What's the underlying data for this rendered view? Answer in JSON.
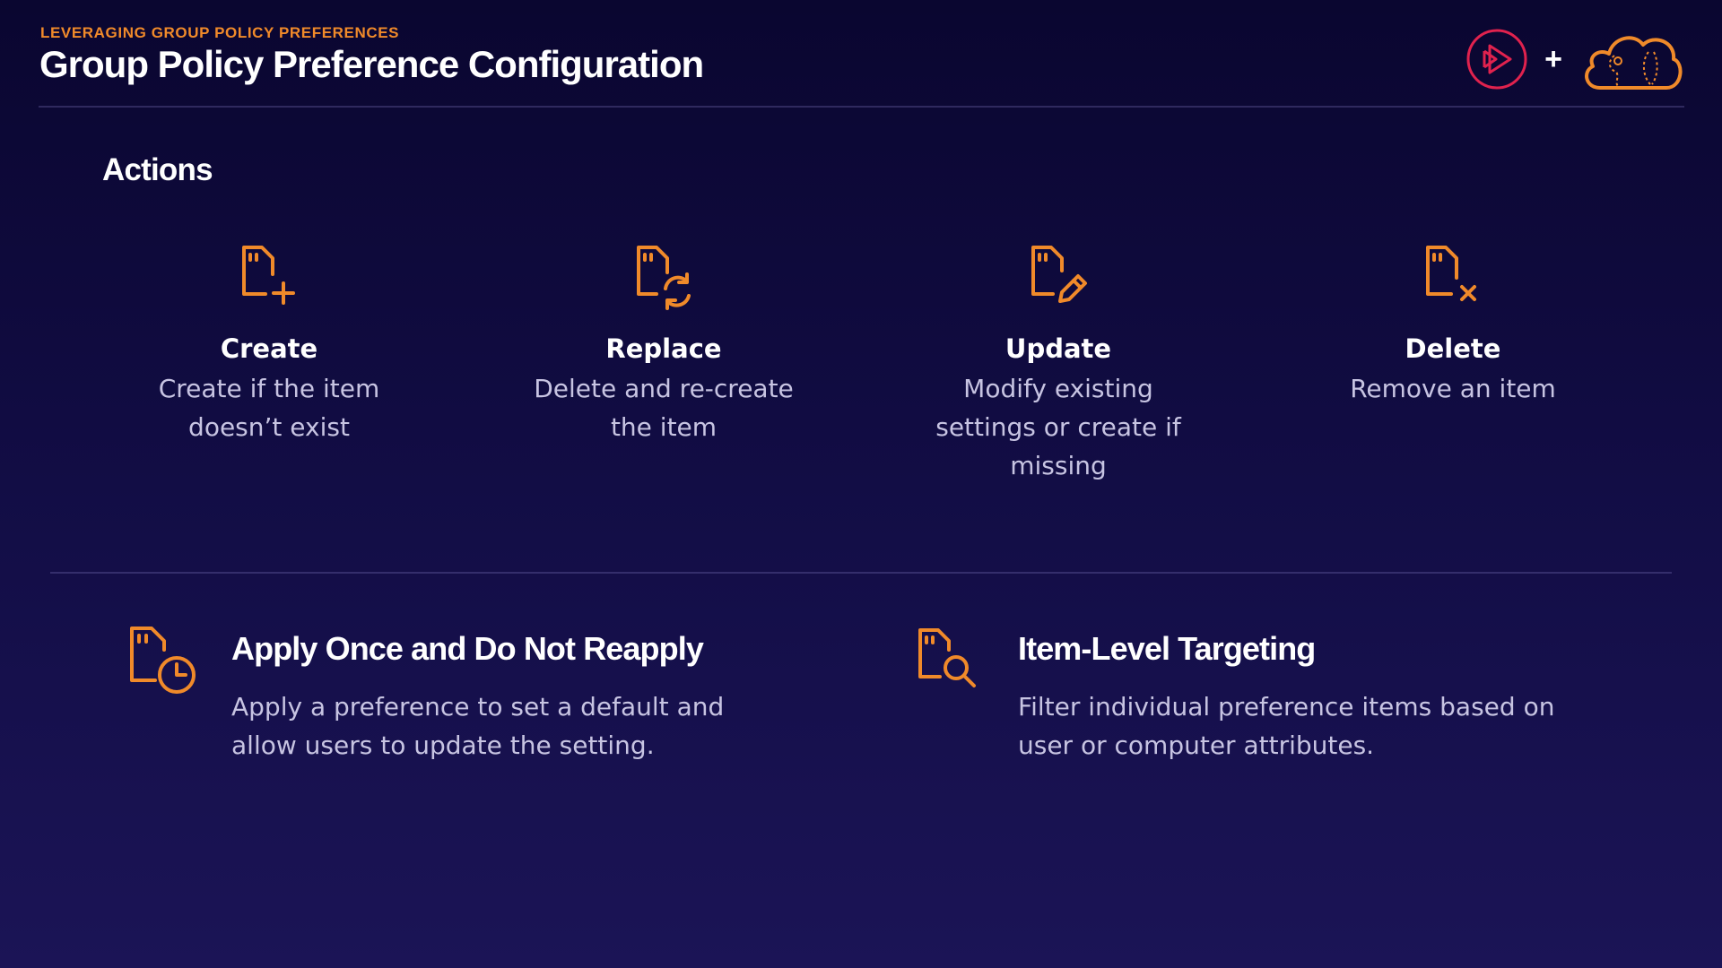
{
  "header": {
    "eyebrow": "LEVERAGING GROUP POLICY PREFERENCES",
    "title": "Group Policy Preference Configuration",
    "plus": "+"
  },
  "section_title": "Actions",
  "actions": [
    {
      "title": "Create",
      "description": "Create if the item doesn’t exist",
      "icon": "file-plus-icon"
    },
    {
      "title": "Replace",
      "description": "Delete and re-create the item",
      "icon": "file-refresh-icon"
    },
    {
      "title": "Update",
      "description": "Modify existing settings or create if missing",
      "icon": "file-edit-icon"
    },
    {
      "title": "Delete",
      "description": "Remove an item",
      "icon": "file-x-icon"
    }
  ],
  "features": [
    {
      "title": "Apply Once and Do Not Reapply",
      "description": "Apply a preference to set a default and allow users to update the setting.",
      "icon": "file-clock-icon"
    },
    {
      "title": "Item-Level Targeting",
      "description": "Filter individual preference items based on user or computer attributes.",
      "icon": "file-search-icon"
    }
  ],
  "colors": {
    "accent": "#f08a2a",
    "play_logo": "#e0224e",
    "background": "#120d45"
  }
}
